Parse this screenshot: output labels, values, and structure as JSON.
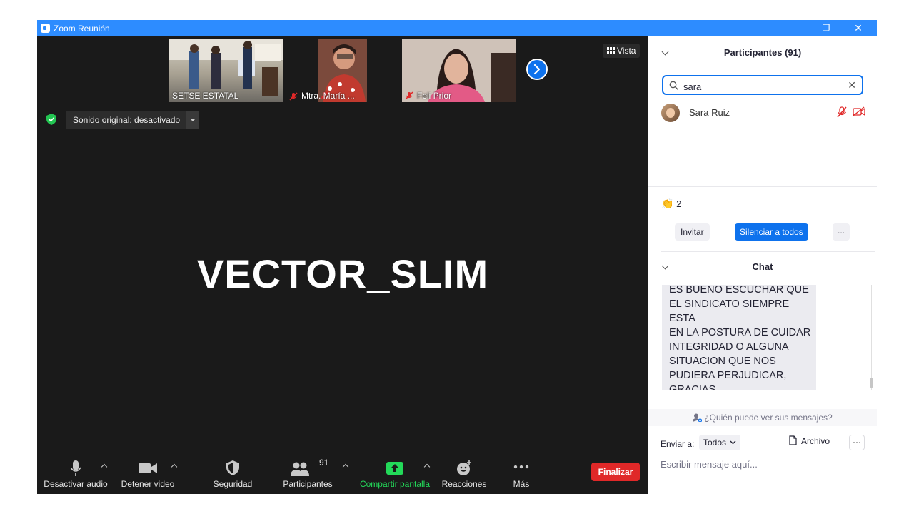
{
  "window": {
    "title": "Zoom Reunión",
    "minimize": "—",
    "restore": "❐",
    "close": "✕"
  },
  "thumbnails": [
    {
      "name": "SETSE ESTATAL",
      "muted": false
    },
    {
      "name": "Mtra. María ...",
      "muted": true
    },
    {
      "name": "Feli Prior",
      "muted": true
    }
  ],
  "view": {
    "label": "Vista"
  },
  "audio_banner": {
    "label": "Sonido original: desactivado"
  },
  "speaker": {
    "name": "VECTOR_SLIM"
  },
  "toolbar": {
    "audio": "Desactivar audio",
    "video": "Detener video",
    "security": "Seguridad",
    "participants": "Participantes",
    "participants_count": "91",
    "share": "Compartir pantalla",
    "reactions": "Reacciones",
    "more": "Más",
    "end": "Finalizar"
  },
  "participants_panel": {
    "title": "Participantes (91)",
    "search_value": "sara",
    "results": [
      {
        "name": "Sara Ruiz"
      }
    ],
    "raised_hands": "2",
    "invite": "Invitar",
    "mute_all": "Silenciar a todos",
    "more": "..."
  },
  "chat": {
    "title": "Chat",
    "message_lines": [
      "ES BUENO ESCUCHAR QUE",
      "EL SINDICATO SIEMPRE ESTA",
      "EN  LA POSTURA  DE CUIDAR",
      "INTEGRIDAD O ALGUNA",
      "SITUACION QUE NOS",
      "PUDIERA PERJUDICAR,",
      "GRACIAS"
    ],
    "who_can_see": "¿Quién puede ver sus mensajes?",
    "send_to_label": "Enviar a:",
    "send_to_value": "Todos",
    "file": "Archivo",
    "more": "···",
    "placeholder": "Escribir mensaje aquí..."
  },
  "colors": {
    "accent": "#0e72ed",
    "titlebar": "#2d8cff",
    "end": "#e02828",
    "share": "#23d959"
  }
}
